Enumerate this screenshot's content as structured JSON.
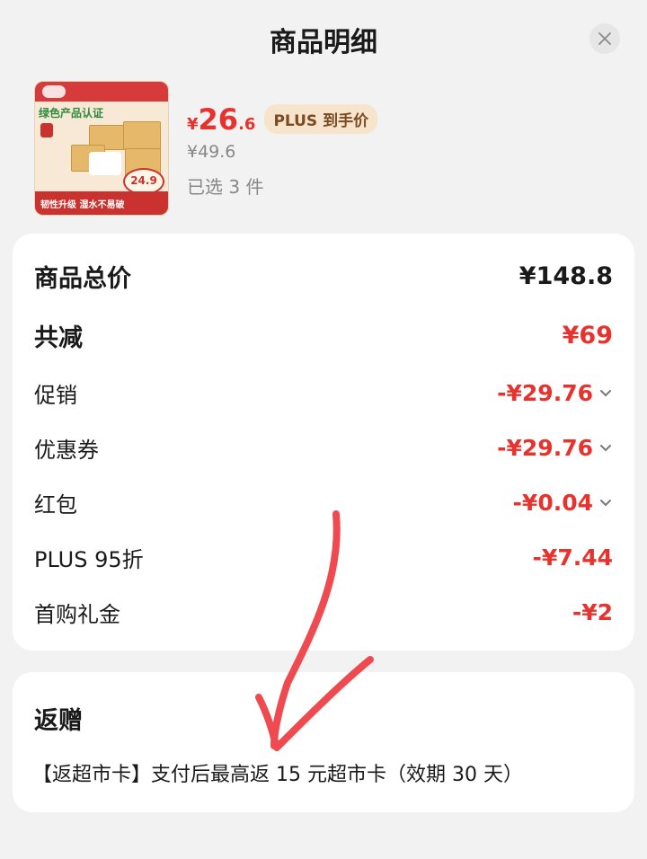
{
  "header": {
    "title": "商品明细"
  },
  "product": {
    "thumb_cert": "绿色产品认证",
    "thumb_slogan": "韧性升级 湿水不易破",
    "thumb_price": "24.9",
    "currency": "¥",
    "price_int": "26",
    "price_dec": ".6",
    "plus_badge": "PLUS 到手价",
    "original_price": "¥49.6",
    "selected": "已选 3 件"
  },
  "summary": {
    "rows": [
      {
        "label": "商品总价",
        "value": "¥148.8"
      },
      {
        "label": "共减",
        "value": "¥69"
      },
      {
        "label": "促销",
        "value": "-¥29.76"
      },
      {
        "label": "优惠券",
        "value": "-¥29.76"
      },
      {
        "label": "红包",
        "value": "-¥0.04"
      },
      {
        "label": "PLUS 95折",
        "value": "-¥7.44"
      },
      {
        "label": "首购礼金",
        "value": "-¥2"
      }
    ]
  },
  "gift": {
    "title": "返赠",
    "text": "【返超市卡】支付后最高返 15 元超市卡（效期 30 天）"
  },
  "colors": {
    "accent_red": "#e8322e",
    "plus_badge_bg": "#f6e4cd",
    "annotation": "#ee4a4f"
  }
}
